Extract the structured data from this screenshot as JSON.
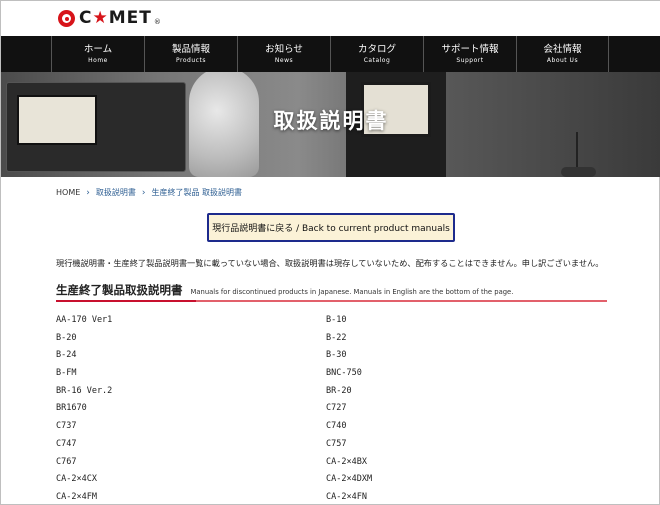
{
  "header": {
    "logo_text_c": "C",
    "logo_text_star": "★",
    "logo_text_rest": "MET",
    "logo_reg": "®"
  },
  "nav": [
    {
      "jp": "ホーム",
      "en": "Home"
    },
    {
      "jp": "製品情報",
      "en": "Products"
    },
    {
      "jp": "お知らせ",
      "en": "News"
    },
    {
      "jp": "カタログ",
      "en": "Catalog"
    },
    {
      "jp": "サポート情報",
      "en": "Support"
    },
    {
      "jp": "会社情報",
      "en": "About Us"
    }
  ],
  "hero": {
    "title": "取扱説明書"
  },
  "breadcrumb": {
    "home": "HOME",
    "level1": "取扱説明書",
    "level2": "生産終了製品 取扱説明書",
    "sep": "›"
  },
  "back_button": {
    "label": "現行品説明書に戻る / Back to current product manuals"
  },
  "notice": "現行機説明書・生産終了製品説明書一覧に載っていない場合、取扱説明書は現存していないため、配布することはできません。申し訳ございません。",
  "section": {
    "title_jp": "生産終了製品取扱説明書",
    "title_en": "Manuals for discontinued products in Japanese. Manuals in English are the bottom of the page."
  },
  "manuals_left": [
    "AA-170 Ver1",
    "B-20",
    "B-24",
    "B-FM",
    "BR-16 Ver.2",
    "BR1670",
    "C737",
    "C747",
    "C767",
    "CA-2×4CX",
    "CA-2×4FM"
  ],
  "manuals_right": [
    "B-10",
    "B-22",
    "B-30",
    "BNC-750",
    "BR-20",
    "C727",
    "C740",
    "C757",
    "CA-2×4BX",
    "CA-2×4DXM",
    "CA-2×4FN"
  ]
}
